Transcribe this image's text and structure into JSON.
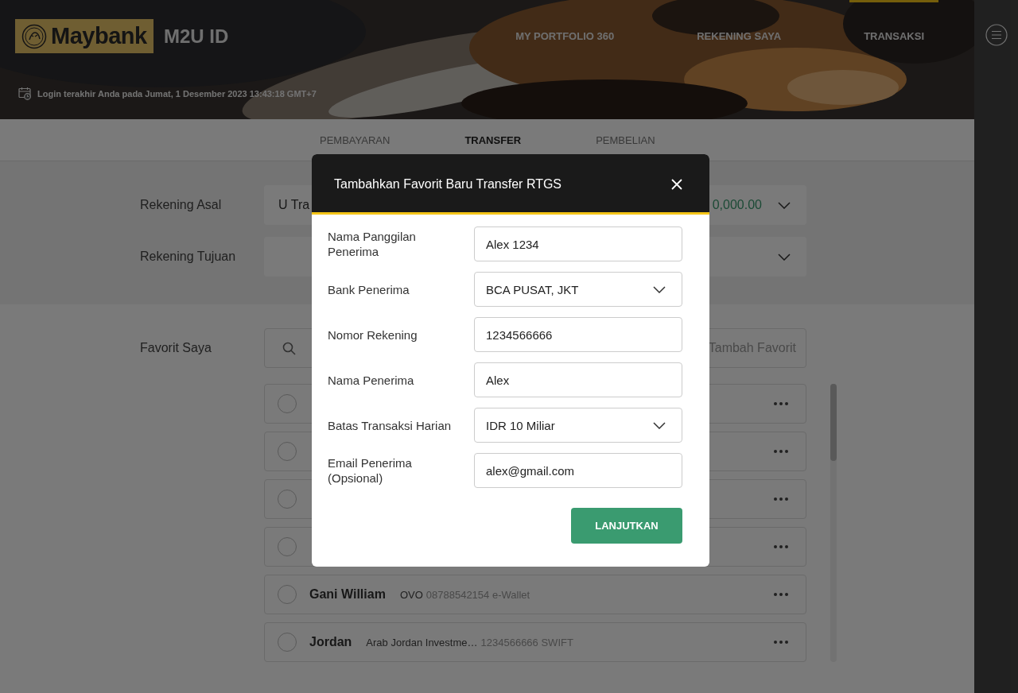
{
  "header": {
    "logo": "Maybank",
    "app_name": "M2U ID",
    "last_login": "Login terakhir Anda pada Jumat, 1 Desember 2023 13:43:18 GMT+7",
    "nav": [
      {
        "label": "MY PORTFOLIO 360",
        "selected": false
      },
      {
        "label": "REKENING SAYA",
        "selected": false
      },
      {
        "label": "TRANSAKSI",
        "selected": true
      }
    ]
  },
  "tabs": [
    {
      "label": "PEMBAYARAN",
      "selected": false
    },
    {
      "label": "TRANSFER",
      "selected": true
    },
    {
      "label": "PEMBELIAN",
      "selected": false
    }
  ],
  "account_form": [
    {
      "label": "Rekening Asal",
      "value": "U Tra",
      "amount": "0,000.00"
    },
    {
      "label": "Rekening Tujuan"
    }
  ],
  "favorites": {
    "label": "Favorit Saya",
    "add_label": "Tambah Favorit",
    "rows": [
      {
        "selected": false
      },
      {
        "selected": false
      },
      {
        "selected": false
      },
      {
        "selected": false
      },
      {
        "selected": false,
        "name": "Gani William",
        "bank": "OVO",
        "account": "08788542154 e-Wallet"
      },
      {
        "selected": false,
        "name": "Jordan",
        "bank": "Arab Jordan Investme…",
        "account": "1234566666 SWIFT"
      }
    ]
  },
  "modal": {
    "title": "Tambahkan Favorit Baru Transfer RTGS",
    "fields": [
      {
        "kind": "input",
        "label": "Nama Panggilan Penerima",
        "value": "Alex 1234"
      },
      {
        "kind": "select",
        "label": "Bank Penerima",
        "value": "BCA PUSAT, JKT"
      },
      {
        "kind": "input",
        "label": "Nomor Rekening",
        "value": "1234566666"
      },
      {
        "kind": "input",
        "label": "Nama Penerima",
        "value": "Alex"
      },
      {
        "kind": "select",
        "label": "Batas Transaksi Harian",
        "value": "IDR 10 Miliar"
      },
      {
        "kind": "input",
        "label": "Email Penerima (Opsional)",
        "value": "alex@gmail.com"
      }
    ],
    "button": "LANJUTKAN"
  }
}
